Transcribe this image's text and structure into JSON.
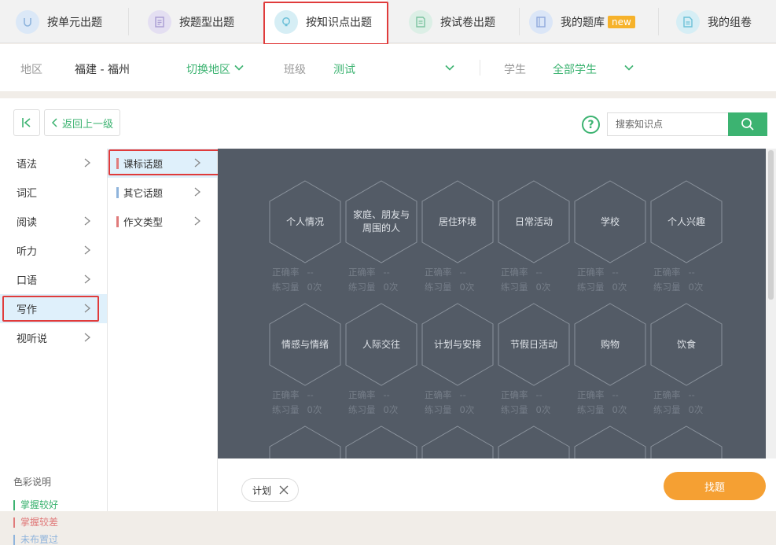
{
  "tabs": [
    {
      "label": "按单元出题",
      "icon": "unit-icon",
      "icon_bg": "#dbe8f7"
    },
    {
      "label": "按题型出题",
      "icon": "list-icon",
      "icon_bg": "#e4dff2"
    },
    {
      "label": "按知识点出题",
      "icon": "bulb-icon",
      "icon_bg": "#d6eef5"
    },
    {
      "label": "按试卷出题",
      "icon": "paper-icon",
      "icon_bg": "#dcefe6"
    },
    {
      "label": "我的题库",
      "badge": "new",
      "icon": "book-icon",
      "icon_bg": "#dbe6f7"
    },
    {
      "label": "我的组卷",
      "icon": "doc-icon",
      "icon_bg": "#d6eef5"
    }
  ],
  "filters": {
    "region_label": "地区",
    "region_value": "福建 - 福州",
    "switch_region": "切换地区",
    "class_label": "班级",
    "class_value": "测试",
    "student_label": "学生",
    "student_value": "全部学生"
  },
  "toolbar": {
    "first_icon": "|<",
    "back_label": "返回上一级",
    "help_icon": "?",
    "search_placeholder": "搜索知识点"
  },
  "categories": [
    "语法",
    "词汇",
    "阅读",
    "听力",
    "口语",
    "写作",
    "视听说"
  ],
  "subcategories": [
    {
      "label": "课标话题",
      "color": "#e07b7b"
    },
    {
      "label": "其它话题",
      "color": "#8fb4dc"
    },
    {
      "label": "作文类型",
      "color": "#e07b7b"
    }
  ],
  "topics": [
    {
      "name": "个人情况",
      "rate_label": "正确率",
      "rate": "--",
      "count_label": "练习量",
      "count": "0次"
    },
    {
      "name": "家庭、朋友与周围的人",
      "rate_label": "正确率",
      "rate": "--",
      "count_label": "练习量",
      "count": "0次"
    },
    {
      "name": "居住环境",
      "rate_label": "正确率",
      "rate": "--",
      "count_label": "练习量",
      "count": "0次"
    },
    {
      "name": "日常活动",
      "rate_label": "正确率",
      "rate": "--",
      "count_label": "练习量",
      "count": "0次"
    },
    {
      "name": "学校",
      "rate_label": "正确率",
      "rate": "--",
      "count_label": "练习量",
      "count": "0次"
    },
    {
      "name": "个人兴趣",
      "rate_label": "正确率",
      "rate": "--",
      "count_label": "练习量",
      "count": "0次"
    },
    {
      "name": "情感与情绪",
      "rate_label": "正确率",
      "rate": "--",
      "count_label": "练习量",
      "count": "0次"
    },
    {
      "name": "人际交往",
      "rate_label": "正确率",
      "rate": "--",
      "count_label": "练习量",
      "count": "0次"
    },
    {
      "name": "计划与安排",
      "rate_label": "正确率",
      "rate": "--",
      "count_label": "练习量",
      "count": "0次"
    },
    {
      "name": "节假日活动",
      "rate_label": "正确率",
      "rate": "--",
      "count_label": "练习量",
      "count": "0次"
    },
    {
      "name": "购物",
      "rate_label": "正确率",
      "rate": "--",
      "count_label": "练习量",
      "count": "0次"
    },
    {
      "name": "饮食",
      "rate_label": "正确率",
      "rate": "--",
      "count_label": "练习量",
      "count": "0次"
    }
  ],
  "legend": {
    "title": "色彩说明",
    "items": [
      {
        "label": "掌握较好",
        "color": "#3cb371"
      },
      {
        "label": "掌握较差",
        "color": "#e07b7b"
      },
      {
        "label": "未布置过",
        "color": "#8fb4dc"
      }
    ]
  },
  "selection": {
    "chip_label": "计划"
  },
  "find_button": "找题",
  "colors": {
    "accent": "#3cb371",
    "highlight": "#e03b3b",
    "canvas": "#535b66",
    "orange": "#f5a033"
  }
}
